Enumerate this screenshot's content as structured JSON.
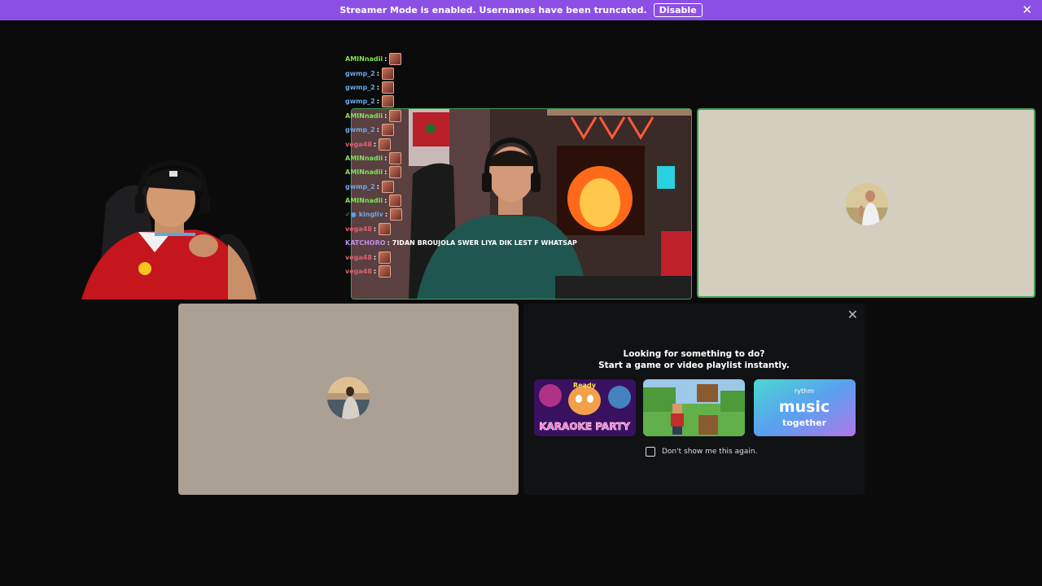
{
  "banner": {
    "message": "Streamer Mode is enabled. Usernames have been truncated.",
    "disable_label": "Disable",
    "close_glyph": "✕"
  },
  "chat": [
    {
      "user": "AMINnadii",
      "color": "#7ee25a",
      "msg": ""
    },
    {
      "user": "gwmp_2",
      "color": "#6aa8e8",
      "msg": ""
    },
    {
      "user": "gwmp_2",
      "color": "#6aa8e8",
      "msg": ""
    },
    {
      "user": "gwmp_2",
      "color": "#6aa8e8",
      "msg": ""
    },
    {
      "user": "AMINnadii",
      "color": "#7ee25a",
      "msg": ""
    },
    {
      "user": "gwmp_2",
      "color": "#6aa8e8",
      "msg": ""
    },
    {
      "user": "vega48",
      "color": "#e06070",
      "msg": ""
    },
    {
      "user": "AMINnadii",
      "color": "#7ee25a",
      "msg": ""
    },
    {
      "user": "AMINnadii",
      "color": "#7ee25a",
      "msg": ""
    },
    {
      "user": "gwmp_2",
      "color": "#6aa8e8",
      "msg": ""
    },
    {
      "user": "AMINnadii",
      "color": "#7ee25a",
      "msg": ""
    },
    {
      "user": "kingliv",
      "color": "#6aa8e8",
      "msg": "",
      "badges": "✓●"
    },
    {
      "user": "vega48",
      "color": "#e06070",
      "msg": ""
    },
    {
      "user": "KATCHORO",
      "color": "#c28ee8",
      "msg": "7IDAN BROUJOLA SWER LIYA DIK LEST F WHATSAP",
      "no_emote": true
    },
    {
      "user": "vega48",
      "color": "#e06070",
      "msg": ""
    },
    {
      "user": "vega48",
      "color": "#e06070",
      "msg": ""
    }
  ],
  "chat_separator": ":",
  "activity": {
    "close_glyph": "✕",
    "heading_line1": "Looking for something to do?",
    "heading_line2": "Start a game or video playlist instantly.",
    "cards": [
      {
        "label": "KARAOKE PARTY",
        "sub": "Ready"
      },
      {
        "label": ""
      },
      {
        "label": "music",
        "sub": "together",
        "brand": "rythm"
      }
    ],
    "dont_show_label": "Don't show me this again."
  },
  "colors": {
    "banner": "#8c4fe6",
    "speaking_border": "#3ea154",
    "background": "#0b0b0c"
  }
}
